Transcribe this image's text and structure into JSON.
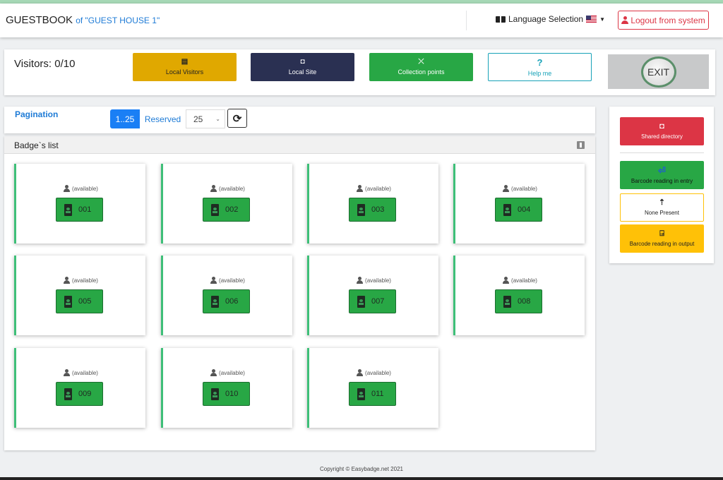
{
  "navbar": {
    "brand": "GUESTBOOK",
    "of_label": "of \"GUEST HOUSE 1\"",
    "language_label": "Language Selection",
    "language_icon": "language-icon",
    "flag_icon": "us-flag-icon",
    "logout_label": "Logout from system",
    "logout_color": "#dc3545"
  },
  "toolbar": {
    "visitors_label": "Visitors: 0/10",
    "buttons": [
      {
        "label": "Local Visitors",
        "icon": "list-icon",
        "glyph": "▤",
        "color": "#e0a800"
      },
      {
        "label": "Local Site",
        "icon": "badge-icon",
        "glyph": "◘",
        "color": "#2a3052"
      },
      {
        "label": "Collection points",
        "icon": "arrows-collapse-icon",
        "glyph": "⤫",
        "color": "#28a745"
      },
      {
        "label": "Help me",
        "icon": "question-icon",
        "glyph": "?",
        "color": "#17a2b8"
      }
    ],
    "exit_label": "EXIT"
  },
  "pagination": {
    "title": "Pagination",
    "active_page": "1..25",
    "reserved_label": "Reserved",
    "per_page": "25",
    "refresh_glyph": "⟳"
  },
  "badges": {
    "title": "Badge`s list",
    "status_label": "(available)",
    "items": [
      "001",
      "002",
      "003",
      "004",
      "005",
      "006",
      "007",
      "008",
      "009",
      "010",
      "011"
    ],
    "accent_color": "#28a745"
  },
  "sidebar": {
    "shared_directory": {
      "label": "Shared directory",
      "glyph": "◘",
      "color": "#dc3545"
    },
    "barcode_entry": {
      "label": "Barcode reading in entry",
      "glyph": "⏎",
      "color": "#28a745"
    },
    "none_present": {
      "label": "None Present",
      "glyph": "⇡"
    },
    "barcode_output": {
      "label": "Barcode reading in output",
      "glyph": "⍈",
      "color": "#ffc107"
    }
  },
  "footer": {
    "copyright": "Copyright © Easybadge.net 2021"
  }
}
